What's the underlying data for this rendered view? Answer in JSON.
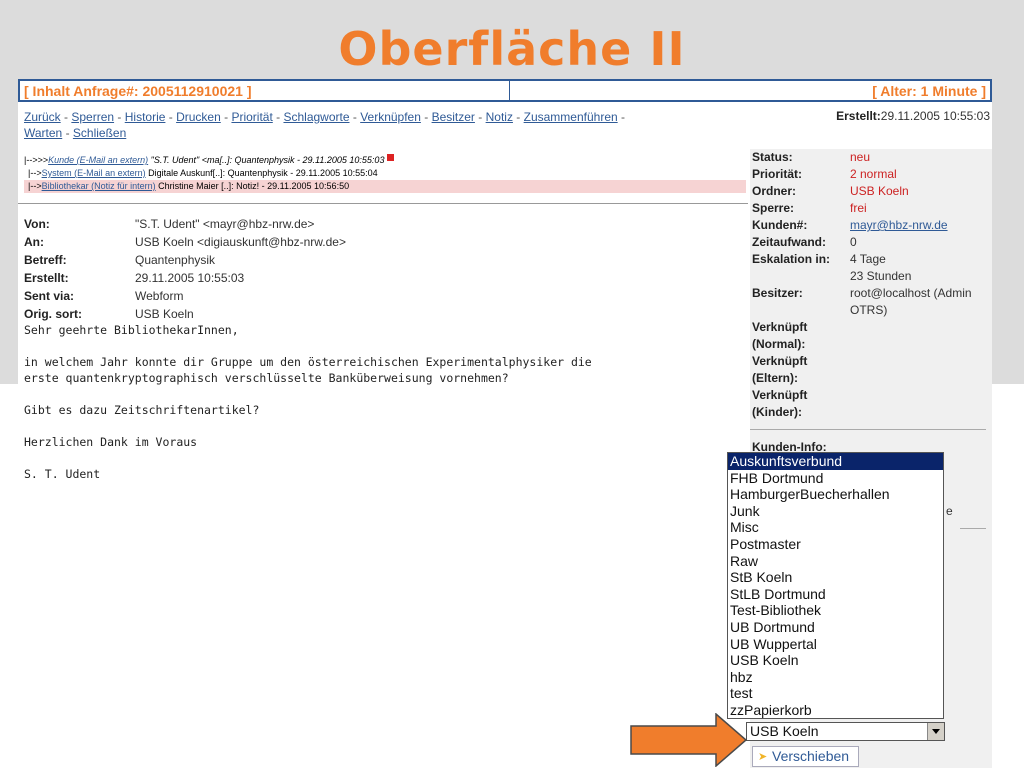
{
  "slide": {
    "title": "Oberfläche II"
  },
  "ticket_bar": {
    "title": "[ Inhalt Anfrage#: 2005112910021 ]",
    "age": "[ Alter: 1 Minute ]"
  },
  "menu": {
    "items": [
      "Zurück",
      "Sperren",
      "Historie",
      "Drucken",
      "Priorität",
      "Schlagworte",
      "Verknüpfen",
      "Besitzer",
      "Notiz",
      "Zusammenführen",
      "Warten",
      "Schließen"
    ],
    "separator": " - "
  },
  "created": {
    "label": "Erstellt:",
    "value": "29.11.2005 10:55:03"
  },
  "thread": [
    {
      "prefix": "|-->>>",
      "link": "Kunde (E-Mail an extern)",
      "text": " \"S.T. Udent\" <ma[..]: Quantenphysik - 29.11.2005 10:55:03"
    },
    {
      "prefix": "|-->",
      "link": "System (E-Mail an extern)",
      "text": " Digitale Auskunf[..]: Quantenphysik - 29.11.2005 10:55:04"
    },
    {
      "prefix": "|-->",
      "link": "Bibliothekar (Notiz für intern)",
      "text": " Christine Maier [..]: Notiz! - 29.11.2005 10:56:50"
    }
  ],
  "headers": [
    {
      "key": "Von:",
      "value": "\"S.T. Udent\" <mayr@hbz-nrw.de>"
    },
    {
      "key": "An:",
      "value": "USB Koeln <digiauskunft@hbz-nrw.de>"
    },
    {
      "key": "Betreff:",
      "value": "Quantenphysik"
    },
    {
      "key": "Erstellt:",
      "value": "29.11.2005 10:55:03"
    },
    {
      "key": "Sent via:",
      "value": "Webform"
    },
    {
      "key": "Orig. sort:",
      "value": "USB Koeln"
    }
  ],
  "message_body": "Sehr geehrte BibliothekarInnen,\n\nin welchem Jahr konnte dir Gruppe um den österreichischen Experimentalphysiker die\nerste quantenkryptographisch verschlüsselte Banküberweisung vornehmen?\n\nGibt es dazu Zeitschriftenartikel?\n\nHerzlichen Dank im Voraus\n\nS. T. Udent",
  "info": {
    "status": {
      "key": "Status:",
      "value": "neu"
    },
    "priority": {
      "key": "Priorität:",
      "value": "2 normal"
    },
    "queue": {
      "key": "Ordner:",
      "value": "USB Koeln"
    },
    "lock": {
      "key": "Sperre:",
      "value": "frei"
    },
    "customer": {
      "key": "Kunden#:",
      "value": "mayr@hbz-nrw.de"
    },
    "time": {
      "key": "Zeitaufwand:",
      "value": "0"
    },
    "escalation": {
      "key": "Eskalation in:",
      "value1": "4 Tage",
      "value2": "23 Stunden"
    },
    "owner": {
      "key": "Besitzer:",
      "value1": "root@localhost (Admin",
      "value2": "OTRS)"
    }
  },
  "links": [
    "Verknüpft",
    "(Normal):",
    "Verknüpft",
    "(Eltern):",
    "Verknüpft",
    "(Kinder):"
  ],
  "customer_info": {
    "label": "Kunden-Info:"
  },
  "peek": "e",
  "queue_dropdown": {
    "options": [
      "Auskunftsverbund",
      "FHB Dortmund",
      "HamburgerBuecherhallen",
      "Junk",
      "Misc",
      "Postmaster",
      "Raw",
      "StB Koeln",
      "StLB Dortmund",
      "Test-Bibliothek",
      "UB Dortmund",
      "UB Wuppertal",
      "USB Koeln",
      "hbz",
      "test",
      "zzPapierkorb"
    ],
    "highlighted": "Auskunftsverbund",
    "selected": "USB Koeln"
  },
  "move_button": {
    "label": "Verschieben"
  },
  "colors": {
    "accent": "#f07d2c",
    "link": "#2f5a96",
    "status_red": "#c22222",
    "highlight": "#0a246a"
  }
}
